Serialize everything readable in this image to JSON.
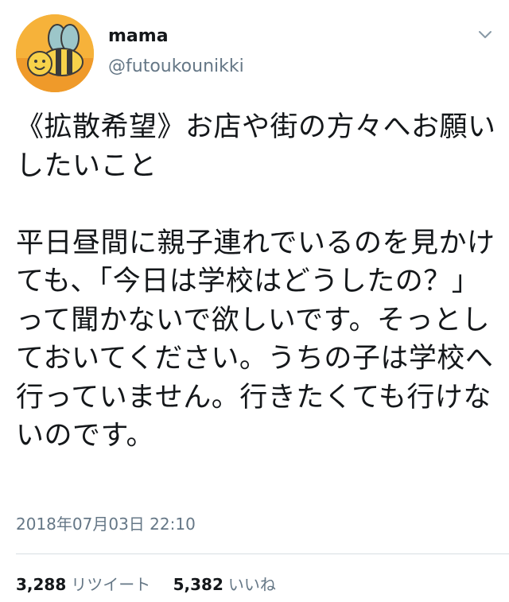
{
  "user": {
    "display_name": "mama",
    "handle": "@futoukounikki"
  },
  "tweet": {
    "paragraphs": [
      "《拡散希望》お店や街の方々へお願いしたいこと",
      "平日昼間に親子連れでいるのを見かけても、「今日は学校はどうしたの？」って聞かないで欲しいです。そっとしておいてください。うちの子は学校へ行っていません。行きたくても行けないのです。"
    ],
    "timestamp": "2018年07月03日 22:10"
  },
  "stats": {
    "retweets_count": "3,288",
    "retweets_label": "リツイート",
    "likes_count": "5,382",
    "likes_label": "いいね"
  },
  "colors": {
    "text": "#14171a",
    "secondary": "#657786",
    "divider": "#d8dee3",
    "avatar_bg": "#f6b23a"
  },
  "icons": {
    "avatar": "bee-illustration",
    "menu": "chevron-down-icon"
  }
}
